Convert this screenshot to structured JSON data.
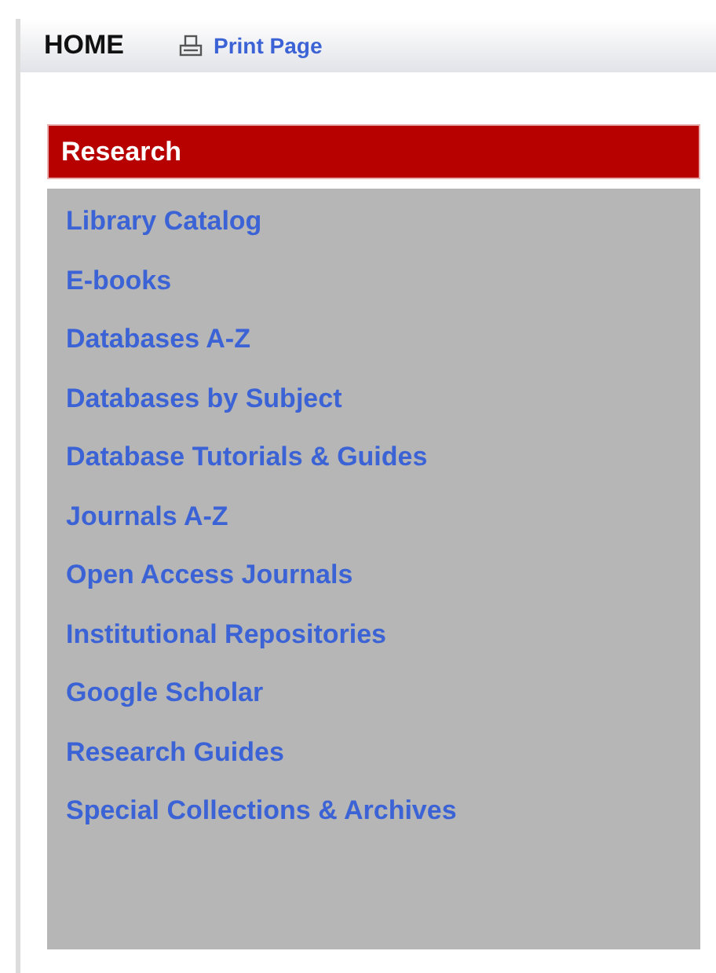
{
  "header": {
    "home": "HOME",
    "print_link": "Print Page"
  },
  "menu": {
    "title": "Research",
    "items": [
      {
        "label": "Library Catalog"
      },
      {
        "label": "E-books"
      },
      {
        "label": "Databases A-Z"
      },
      {
        "label": "Databases by Subject"
      },
      {
        "label": "Database Tutorials & Guides"
      },
      {
        "label": "Journals A-Z"
      },
      {
        "label": "Open Access Journals"
      },
      {
        "label": "Institutional Repositories"
      },
      {
        "label": "Google Scholar"
      },
      {
        "label": "Research Guides"
      },
      {
        "label": "Special Collections & Archives"
      }
    ]
  }
}
